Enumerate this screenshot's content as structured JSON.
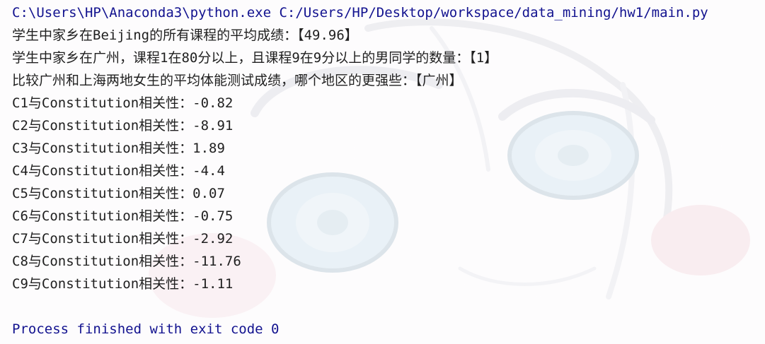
{
  "console": {
    "command_line": "C:\\Users\\HP\\Anaconda3\\python.exe C:/Users/HP/Desktop/workspace/data_mining/hw1/main.py",
    "outputs": [
      "学生中家乡在Beijing的所有课程的平均成绩：【49.96】",
      "学生中家乡在广州，课程1在80分以上，且课程9在9分以上的男同学的数量：【1】",
      "比较广州和上海两地女生的平均体能测试成绩，哪个地区的更强些：【广州】",
      "C1与Constitution相关性：-0.82",
      "C2与Constitution相关性：-8.91",
      "C3与Constitution相关性：1.89",
      "C4与Constitution相关性：-4.4",
      "C5与Constitution相关性：0.07",
      "C6与Constitution相关性：-0.75",
      "C7与Constitution相关性：-2.92",
      "C8与Constitution相关性：-11.76",
      "C9与Constitution相关性：-1.11"
    ],
    "exit_message": "Process finished with exit code 0"
  },
  "colors": {
    "text": "#1f1f1f",
    "path": "#12128f",
    "background": "#fdfcfd"
  }
}
